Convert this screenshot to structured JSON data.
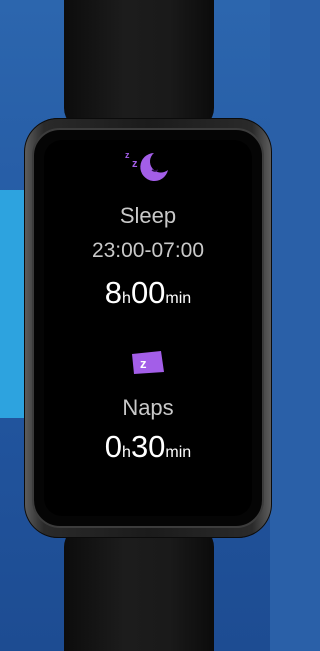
{
  "sleep": {
    "icon": "sleeping-moon-icon",
    "label": "Sleep",
    "range": "23:00-07:00",
    "hours": "8",
    "hours_unit": "h",
    "minutes": "00",
    "minutes_unit": "min"
  },
  "naps": {
    "icon": "nap-zz-icon",
    "label": "Naps",
    "hours": "0",
    "hours_unit": "h",
    "minutes": "30",
    "minutes_unit": "min"
  },
  "colors": {
    "background": "#2a60a8",
    "accent_stripe": "#2da3df",
    "icon_purple": "#a35ee8",
    "text_primary": "#ffffff",
    "text_secondary": "#c9c9c9"
  }
}
